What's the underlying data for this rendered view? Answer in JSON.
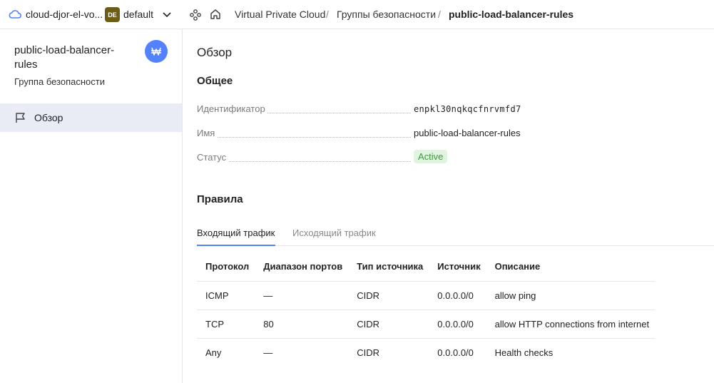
{
  "topbar": {
    "cloud_name": "cloud-djor-el-vo...",
    "folder_badge": "DE",
    "folder_name": "default",
    "breadcrumbs": [
      "Virtual Private Cloud",
      "Группы безопасности",
      "public-load-balancer-rules"
    ],
    "separator": "/"
  },
  "sidebar": {
    "title": "public-load-balancer-rules",
    "subtitle": "Группа безопасности",
    "items": [
      {
        "label": "Обзор",
        "icon": "flag-icon"
      }
    ]
  },
  "main": {
    "heading": "Обзор",
    "general_heading": "Общее",
    "props": {
      "id_label": "Идентификатор",
      "id_value": "enpkl30nqkqcfnrvmfd7",
      "name_label": "Имя",
      "name_value": "public-load-balancer-rules",
      "status_label": "Статус",
      "status_value": "Active"
    },
    "rules_heading": "Правила",
    "tabs": [
      "Входящий трафик",
      "Исходящий трафик"
    ],
    "table": {
      "headers": [
        "Протокол",
        "Диапазон портов",
        "Тип источника",
        "Источник",
        "Описание"
      ],
      "rows": [
        [
          "ICMP",
          "—",
          "CIDR",
          "0.0.0.0/0",
          "allow ping"
        ],
        [
          "TCP",
          "80",
          "CIDR",
          "0.0.0.0/0",
          "allow HTTP connections from internet"
        ],
        [
          "Any",
          "—",
          "CIDR",
          "0.0.0.0/0",
          "Health checks"
        ]
      ]
    }
  },
  "colors": {
    "accent": "#5282ff",
    "folder_badge": "#6b5c16",
    "status_bg": "#e0f4e0",
    "status_fg": "#3a9b3a",
    "sidebar_active": "#e9ecf5"
  }
}
